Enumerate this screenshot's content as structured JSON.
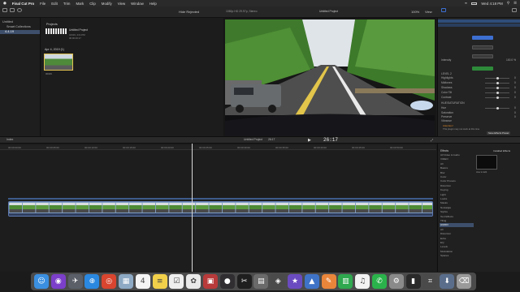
{
  "menubar": {
    "apple": "",
    "app": "Final Cut Pro",
    "items": [
      "File",
      "Edit",
      "Trim",
      "Mark",
      "Clip",
      "Modify",
      "View",
      "Window",
      "Help"
    ],
    "clock": "Wed 4:18 PM"
  },
  "toolbar": {
    "hide_rejected": "Hide Rejected",
    "format": "1080p HD 29.97p, Stereo",
    "project": "Untitled Project",
    "zoom": "100%",
    "view": "View"
  },
  "library": {
    "items": [
      "Untitled",
      "Smart Collections",
      "4-4-19"
    ]
  },
  "browser": {
    "projects_header": "Projects",
    "project_name": "Untitled Project",
    "project_meta1": "4/4/19, 4:21 PM",
    "project_meta2": "00:00:26:17",
    "date_header": "Apr 4, 2019",
    "date_count": "(1)",
    "clip_label": "00049",
    "status": "1 of 2 selected, 26:17"
  },
  "viewer": {
    "timecode": "26:17"
  },
  "inspector": {
    "rows": [
      {
        "label": "Intensity",
        "value": "100.0 %"
      },
      {
        "label": "LEVEL 2",
        "value": ""
      },
      {
        "label": "Highlights",
        "value": "0"
      },
      {
        "label": "Midtones",
        "value": "0"
      },
      {
        "label": "Shadows",
        "value": "0"
      },
      {
        "label": "Color Tilt",
        "value": "0"
      },
      {
        "label": "Contrast",
        "value": "0"
      },
      {
        "label": "HUE/SATURATION",
        "value": ""
      },
      {
        "label": "Hue",
        "value": "0"
      },
      {
        "label": "Saturation",
        "value": "0"
      },
      {
        "label": "Preserve",
        "value": "0"
      },
      {
        "label": "Vibrance",
        "value": ""
      }
    ],
    "note_title": "Attention!",
    "note_text": "This plugin may not work at this time",
    "save_label": "Save Effects Preset"
  },
  "timeline": {
    "index": "Index",
    "title": "Untitled Project",
    "duration": "26:17",
    "ticks": [
      "00:00:00:00",
      "00:00:05:00",
      "00:00:10:00",
      "00:00:15:00",
      "00:00:20:00",
      "00:00:25:00",
      "00:00:30:00",
      "00:00:35:00",
      "00:00:40:00",
      "00:00:45:00",
      "00:00:50:00"
    ]
  },
  "effects": {
    "header": "Effects",
    "installed": "Installed Effects",
    "categories": [
      "All Video & Audio",
      "VIDEO",
      "All",
      "Basics",
      "Blur",
      "Color",
      "Color Presets",
      "Distortion",
      "Keying",
      "Light",
      "Looks",
      "Masks",
      "Nostalgia",
      "Stylize",
      "Text Effects",
      "Tiling",
      "AUDIO",
      "All",
      "Distortion",
      "Echo",
      "EQ",
      "Levels",
      "Modulation",
      "Spaces"
    ],
    "selected_index": 16,
    "item_label": "How to Edit"
  },
  "dock": {
    "icons": [
      {
        "name": "finder-icon",
        "glyph": "☺",
        "color": "#3b8fe0"
      },
      {
        "name": "siri-icon",
        "glyph": "◉",
        "color": "#7b3fc9"
      },
      {
        "name": "launchpad-icon",
        "glyph": "✈",
        "color": "#5a5f68"
      },
      {
        "name": "safari-icon",
        "glyph": "⊕",
        "color": "#2a88e0"
      },
      {
        "name": "chrome-icon",
        "glyph": "◎",
        "color": "#d9452f"
      },
      {
        "name": "preview-icon",
        "glyph": "▦",
        "color": "#8da9c4"
      },
      {
        "name": "calendar-icon",
        "glyph": "4",
        "color": "#f4f4f4"
      },
      {
        "name": "notes-icon",
        "glyph": "≡",
        "color": "#f2d04a"
      },
      {
        "name": "reminders-icon",
        "glyph": "☑",
        "color": "#eeeeee"
      },
      {
        "name": "photos-icon",
        "glyph": "✿",
        "color": "#e9e9e9"
      },
      {
        "name": "photo-booth-icon",
        "glyph": "▣",
        "color": "#b83a3a"
      },
      {
        "name": "obs-icon",
        "glyph": "●",
        "color": "#302e31"
      },
      {
        "name": "final-cut-icon",
        "glyph": "✂",
        "color": "#1f1f1f"
      },
      {
        "name": "compressor-icon",
        "glyph": "▤",
        "color": "#6a6a6a"
      },
      {
        "name": "motion-icon",
        "glyph": "◈",
        "color": "#4a4a4a"
      },
      {
        "name": "imovie-icon",
        "glyph": "★",
        "color": "#6b4bc0"
      },
      {
        "name": "keynote-icon",
        "glyph": "▲",
        "color": "#3f73c8"
      },
      {
        "name": "pages-icon",
        "glyph": "✎",
        "color": "#e9853a"
      },
      {
        "name": "numbers-icon",
        "glyph": "▥",
        "color": "#2fa84f"
      },
      {
        "name": "itunes-icon",
        "glyph": "♫",
        "color": "#f2f2f2"
      },
      {
        "name": "whatsapp-icon",
        "glyph": "✆",
        "color": "#2bb34b"
      },
      {
        "name": "system-preferences-icon",
        "glyph": "⚙",
        "color": "#8a8a8a"
      },
      {
        "name": "terminal-icon",
        "glyph": "▮",
        "color": "#2a2a2a"
      },
      {
        "name": "screenshot-icon",
        "glyph": "⌗",
        "color": "#4a4a4a"
      },
      {
        "name": "downloads-icon",
        "glyph": "⬇",
        "color": "#5a6e8c"
      },
      {
        "name": "trash-icon",
        "glyph": "⌫",
        "color": "#9a9a9a"
      }
    ]
  },
  "colors": {
    "accent": "#3d6fd1",
    "selection": "#3d4f6b",
    "clip": "#5e7ab0",
    "warning": "#e08a2a"
  }
}
